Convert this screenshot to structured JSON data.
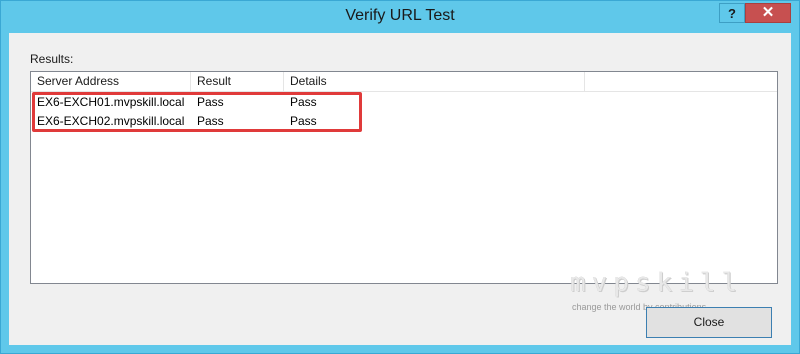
{
  "window": {
    "title": "Verify URL Test",
    "help_label": "?",
    "close_label": "✕"
  },
  "results": {
    "label": "Results:",
    "columns": [
      "Server Address",
      "Result",
      "Details",
      ""
    ],
    "rows": [
      {
        "server": "EX6-EXCH01.mvpskill.local",
        "result": "Pass",
        "details": "Pass"
      },
      {
        "server": "EX6-EXCH02.mvpskill.local",
        "result": "Pass",
        "details": "Pass"
      }
    ]
  },
  "watermark": {
    "logo": "mvpskill",
    "tagline": "change the world by contributions"
  },
  "buttons": {
    "close_label": "Close"
  },
  "colors": {
    "titlebar": "#5fc8ea",
    "close_button": "#c75050",
    "highlight": "#e03a3a"
  }
}
